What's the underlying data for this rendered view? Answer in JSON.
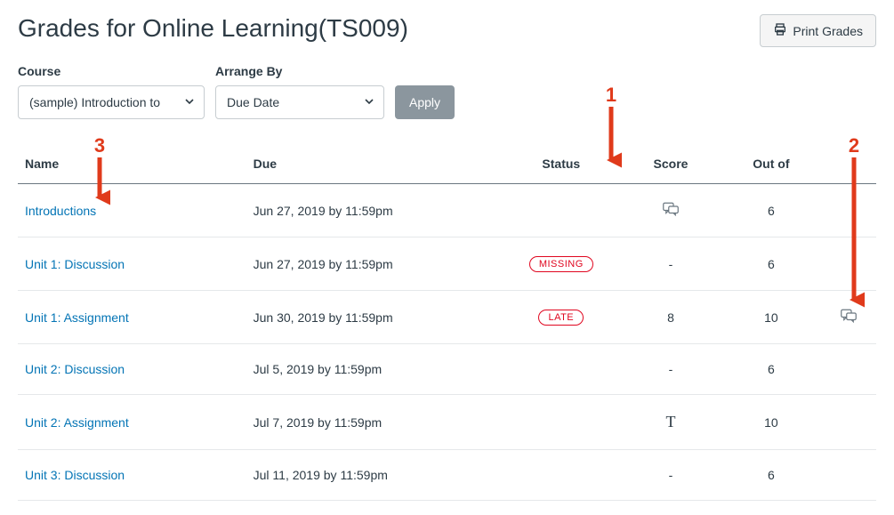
{
  "header": {
    "title": "Grades for Online Learning(TS009)",
    "print_label": "Print Grades"
  },
  "filters": {
    "course_label": "Course",
    "course_value": "(sample) Introduction to",
    "arrange_label": "Arrange By",
    "arrange_value": "Due Date",
    "apply_label": "Apply"
  },
  "table": {
    "headers": {
      "name": "Name",
      "due": "Due",
      "status": "Status",
      "score": "Score",
      "outof": "Out of"
    },
    "rows": [
      {
        "name": "Introductions",
        "due": "Jun 27, 2019 by 11:59pm",
        "status": "",
        "score_kind": "icon",
        "score": "",
        "outof": "6",
        "has_comment": false
      },
      {
        "name": "Unit 1: Discussion",
        "due": "Jun 27, 2019 by 11:59pm",
        "status": "MISSING",
        "score_kind": "text",
        "score": "-",
        "outof": "6",
        "has_comment": false
      },
      {
        "name": "Unit 1: Assignment",
        "due": "Jun 30, 2019 by 11:59pm",
        "status": "LATE",
        "score_kind": "text",
        "score": "8",
        "outof": "10",
        "has_comment": true
      },
      {
        "name": "Unit 2: Discussion",
        "due": "Jul 5, 2019 by 11:59pm",
        "status": "",
        "score_kind": "text",
        "score": "-",
        "outof": "6",
        "has_comment": false
      },
      {
        "name": "Unit 2: Assignment",
        "due": "Jul 7, 2019 by 11:59pm",
        "status": "",
        "score_kind": "T",
        "score": "T",
        "outof": "10",
        "has_comment": false
      },
      {
        "name": "Unit 3: Discussion",
        "due": "Jul 11, 2019 by 11:59pm",
        "status": "",
        "score_kind": "text",
        "score": "-",
        "outof": "6",
        "has_comment": false
      }
    ]
  },
  "annotations": {
    "a1": "1",
    "a2": "2",
    "a3": "3"
  }
}
